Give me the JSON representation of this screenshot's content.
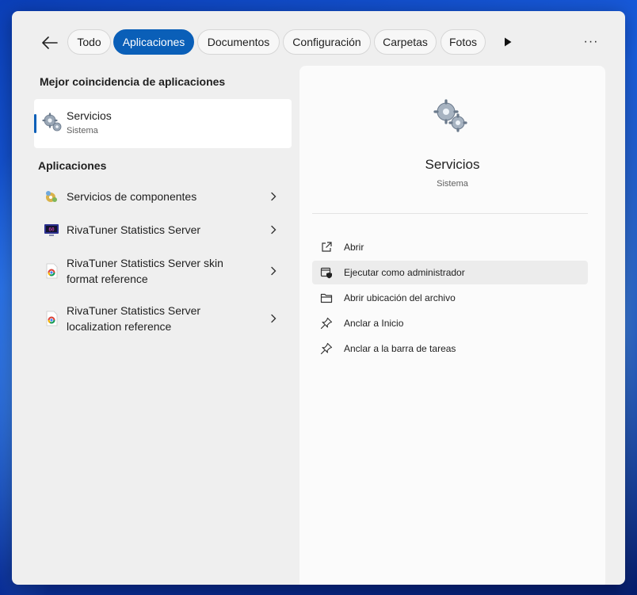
{
  "filters": {
    "back_label": "Atrás",
    "chips": [
      "Todo",
      "Aplicaciones",
      "Documentos",
      "Configuración",
      "Carpetas",
      "Fotos"
    ],
    "active": "Aplicaciones",
    "more_label": "···"
  },
  "left": {
    "best_match_heading": "Mejor coincidencia de aplicaciones",
    "best_match": {
      "name": "Servicios",
      "subtitle": "Sistema",
      "icon": "gears-icon"
    },
    "apps_heading": "Aplicaciones",
    "apps": [
      {
        "label": "Servicios de componentes",
        "icon": "component-services-icon"
      },
      {
        "label": "RivaTuner Statistics Server",
        "icon": "rivatuner-icon"
      },
      {
        "label": "RivaTuner Statistics Server skin format reference",
        "icon": "chrome-document-icon"
      },
      {
        "label": "RivaTuner Statistics Server localization reference",
        "icon": "chrome-document-icon"
      }
    ]
  },
  "detail": {
    "name": "Servicios",
    "subtitle": "Sistema",
    "actions": [
      {
        "label": "Abrir",
        "icon": "open-external-icon"
      },
      {
        "label": "Ejecutar como administrador",
        "icon": "admin-shield-icon"
      },
      {
        "label": "Abrir ubicación del archivo",
        "icon": "folder-icon"
      },
      {
        "label": "Anclar a Inicio",
        "icon": "pin-icon"
      },
      {
        "label": "Anclar a la barra de tareas",
        "icon": "pin-icon"
      }
    ]
  },
  "colors": {
    "accent": "#0a5fb8",
    "panel": "#efefef",
    "detail_bg": "#fbfbfb"
  }
}
